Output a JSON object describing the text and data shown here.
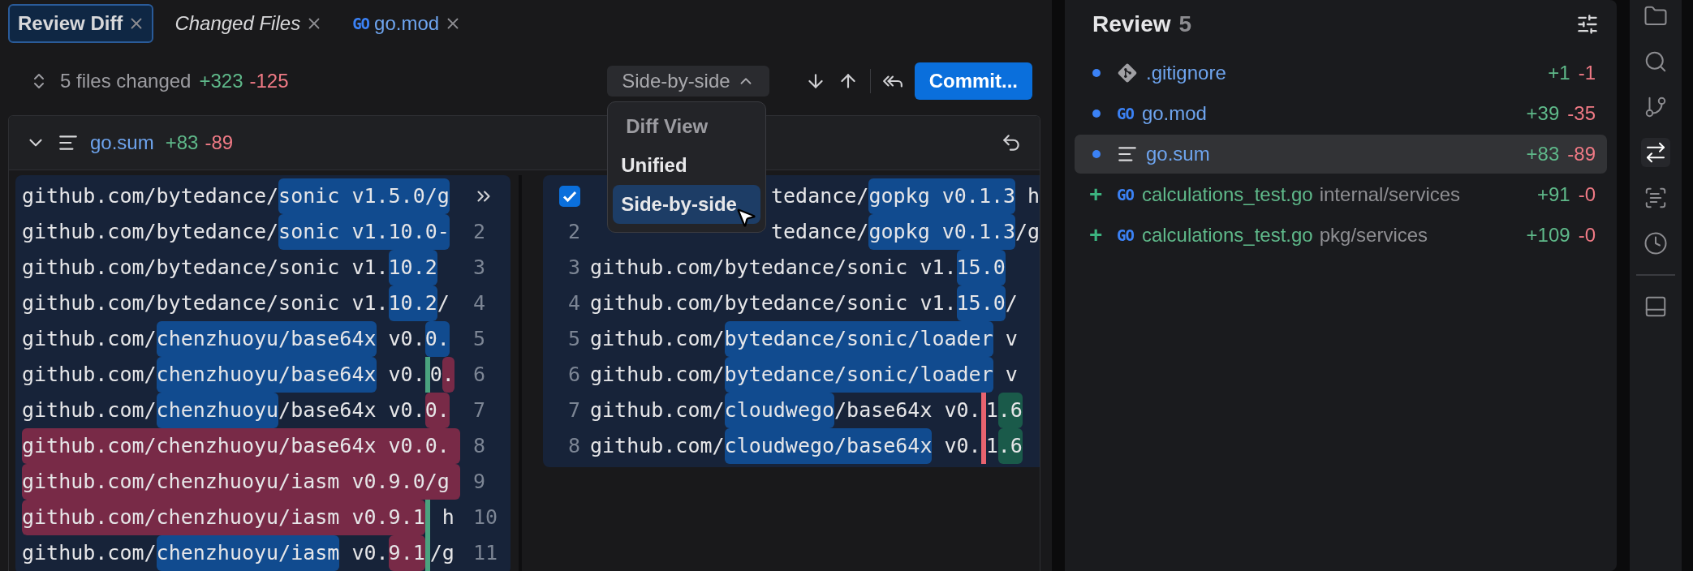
{
  "tabs": [
    {
      "label": "Review Diff",
      "selected": true,
      "italic": false
    },
    {
      "label": "Changed Files",
      "selected": false,
      "italic": true
    },
    {
      "label": "go.mod",
      "selected": false,
      "italic": false,
      "kind": "go",
      "icon_label": "GO"
    }
  ],
  "toolbar": {
    "summary": "5 files changed",
    "added": "+323",
    "removed": "-125",
    "view_button": "Side-by-side",
    "commit_button": "Commit...",
    "view_menu": {
      "title": "Diff View",
      "options": [
        {
          "label": "Unified",
          "selected": false
        },
        {
          "label": "Side-by-side",
          "selected": true
        }
      ]
    }
  },
  "file_diff": {
    "expanded": true,
    "name": "go.sum",
    "added": "+83",
    "removed": "-89",
    "left_lines": [
      {
        "removed": false,
        "segments": [
          {
            "text": "github.com/bytedance/"
          },
          {
            "text": "sonic v1.5.0/g",
            "kind": "changed"
          }
        ]
      },
      {
        "number": "2",
        "removed": false,
        "segments": [
          {
            "text": "github.com/bytedance/"
          },
          {
            "text": "sonic v1.10.0-",
            "kind": "changed"
          }
        ]
      },
      {
        "number": "3",
        "removed": false,
        "segments": [
          {
            "text": "github.com/bytedance/sonic v1."
          },
          {
            "text": "10.2",
            "kind": "changed"
          }
        ]
      },
      {
        "number": "4",
        "removed": false,
        "segments": [
          {
            "text": "github.com/bytedance/sonic v1."
          },
          {
            "text": "10.2",
            "kind": "changed"
          },
          {
            "text": "/"
          }
        ]
      },
      {
        "number": "5",
        "removed": false,
        "segments": [
          {
            "text": "github.com/"
          },
          {
            "text": "chenzhuoyu/base64x",
            "kind": "changed"
          },
          {
            "text": " v0."
          },
          {
            "text": "0.",
            "kind": "changed"
          }
        ]
      },
      {
        "number": "6",
        "removed": false,
        "segments": [
          {
            "text": "github.com/"
          },
          {
            "text": "chenzhuoyu/base64x",
            "kind": "changed"
          },
          {
            "text": " v0."
          },
          {
            "kind": "marker",
            "color": "#4aa37f"
          },
          {
            "text": "0"
          },
          {
            "text": ".",
            "kind": "deleted"
          }
        ]
      },
      {
        "number": "7",
        "removed": false,
        "segments": [
          {
            "text": "github.com/"
          },
          {
            "text": "chenzhuoyu",
            "kind": "changed"
          },
          {
            "text": "/base64x v0."
          },
          {
            "text": "0.",
            "kind": "deleted"
          }
        ]
      },
      {
        "number": "8",
        "removed": true,
        "segments": [
          {
            "text": "github.com/chenzhuoyu/base64x v0.0."
          }
        ]
      },
      {
        "number": "9",
        "removed": true,
        "segments": [
          {
            "text": "github.com/chenzhuoyu/iasm v0.9.0/g"
          }
        ]
      },
      {
        "number": "10",
        "removed": false,
        "segments": [
          {
            "text": "github.com/chenzhuoyu/iasm v0.9.1",
            "kind": "deleted"
          },
          {
            "kind": "marker",
            "color": "#4aa37f"
          },
          {
            "text": " h"
          }
        ]
      },
      {
        "number": "11",
        "removed": false,
        "segments": [
          {
            "text": "github.com/"
          },
          {
            "text": "chenzhuoyu/iasm",
            "kind": "changed"
          },
          {
            "text": " v0."
          },
          {
            "text": "9.1",
            "kind": "deleted"
          },
          {
            "kind": "marker",
            "color": "#4aa37f"
          },
          {
            "text": "/g"
          }
        ]
      }
    ],
    "right_lines": [
      {
        "checked": true,
        "covered": true,
        "segments": [
          {
            "text": "tedance/"
          },
          {
            "text": "gopkg v0.1.3",
            "kind": "changed"
          },
          {
            "text": " h"
          }
        ]
      },
      {
        "number": "2",
        "covered": true,
        "segments": [
          {
            "text": "tedance/"
          },
          {
            "text": "gopkg v0.1.3",
            "kind": "changed"
          },
          {
            "text": "/g"
          }
        ]
      },
      {
        "number": "3",
        "covered": false,
        "segments": [
          {
            "text": "github.com/bytedance/sonic v1."
          },
          {
            "text": "15.0",
            "kind": "changed"
          }
        ]
      },
      {
        "number": "4",
        "covered": false,
        "segments": [
          {
            "text": "github.com/bytedance/sonic v1."
          },
          {
            "text": "15.0",
            "kind": "changed"
          },
          {
            "text": "/"
          }
        ]
      },
      {
        "number": "5",
        "covered": false,
        "segments": [
          {
            "text": "github.com/"
          },
          {
            "text": "bytedance/sonic/loader",
            "kind": "changed"
          },
          {
            "text": " v"
          }
        ]
      },
      {
        "number": "6",
        "covered": false,
        "segments": [
          {
            "text": "github.com/"
          },
          {
            "text": "bytedance/sonic/loader",
            "kind": "changed"
          },
          {
            "text": " v"
          }
        ]
      },
      {
        "number": "7",
        "covered": false,
        "segments": [
          {
            "text": "github.com/"
          },
          {
            "text": "cloudwego",
            "kind": "changed"
          },
          {
            "text": "/base64x v0."
          },
          {
            "kind": "marker",
            "color": "#e8636f"
          },
          {
            "text": "1"
          },
          {
            "text": ".6",
            "kind": "added"
          }
        ]
      },
      {
        "number": "8",
        "covered": false,
        "segments": [
          {
            "text": "github.com/"
          },
          {
            "text": "cloudwego/base64x",
            "kind": "changed"
          },
          {
            "text": " v0."
          },
          {
            "kind": "marker",
            "color": "#e8636f"
          },
          {
            "text": "1"
          },
          {
            "text": ".6",
            "kind": "added"
          }
        ]
      }
    ]
  },
  "review": {
    "title": "Review",
    "count": "5",
    "files": [
      {
        "new": false,
        "kind": "git",
        "name": ".gitignore",
        "added": "+1",
        "removed": "-1",
        "selected": false
      },
      {
        "new": false,
        "kind": "go",
        "icon_label": "GO",
        "name": "go.mod",
        "added": "+39",
        "removed": "-35",
        "selected": false
      },
      {
        "new": false,
        "kind": "lines",
        "name": "go.sum",
        "added": "+83",
        "removed": "-89",
        "selected": true
      },
      {
        "new": true,
        "status_mark": "+",
        "kind": "go",
        "icon_label": "GO",
        "name": "calculations_test.go",
        "path": "internal/services",
        "added": "+91",
        "removed": "-0",
        "selected": false
      },
      {
        "new": true,
        "status_mark": "+",
        "kind": "go",
        "icon_label": "GO",
        "name": "calculations_test.go",
        "path": "pkg/services",
        "added": "+109",
        "removed": "-0",
        "selected": false
      }
    ]
  },
  "activity_bar": {
    "top": [
      {
        "kind": "folder",
        "selected": false
      },
      {
        "kind": "search",
        "selected": false
      },
      {
        "kind": "branch",
        "selected": false
      },
      {
        "kind": "compare",
        "selected": true
      },
      {
        "kind": "scan",
        "selected": false
      },
      {
        "kind": "history",
        "selected": false
      }
    ],
    "bottom": [
      {
        "kind": "panel",
        "selected": false
      }
    ]
  }
}
